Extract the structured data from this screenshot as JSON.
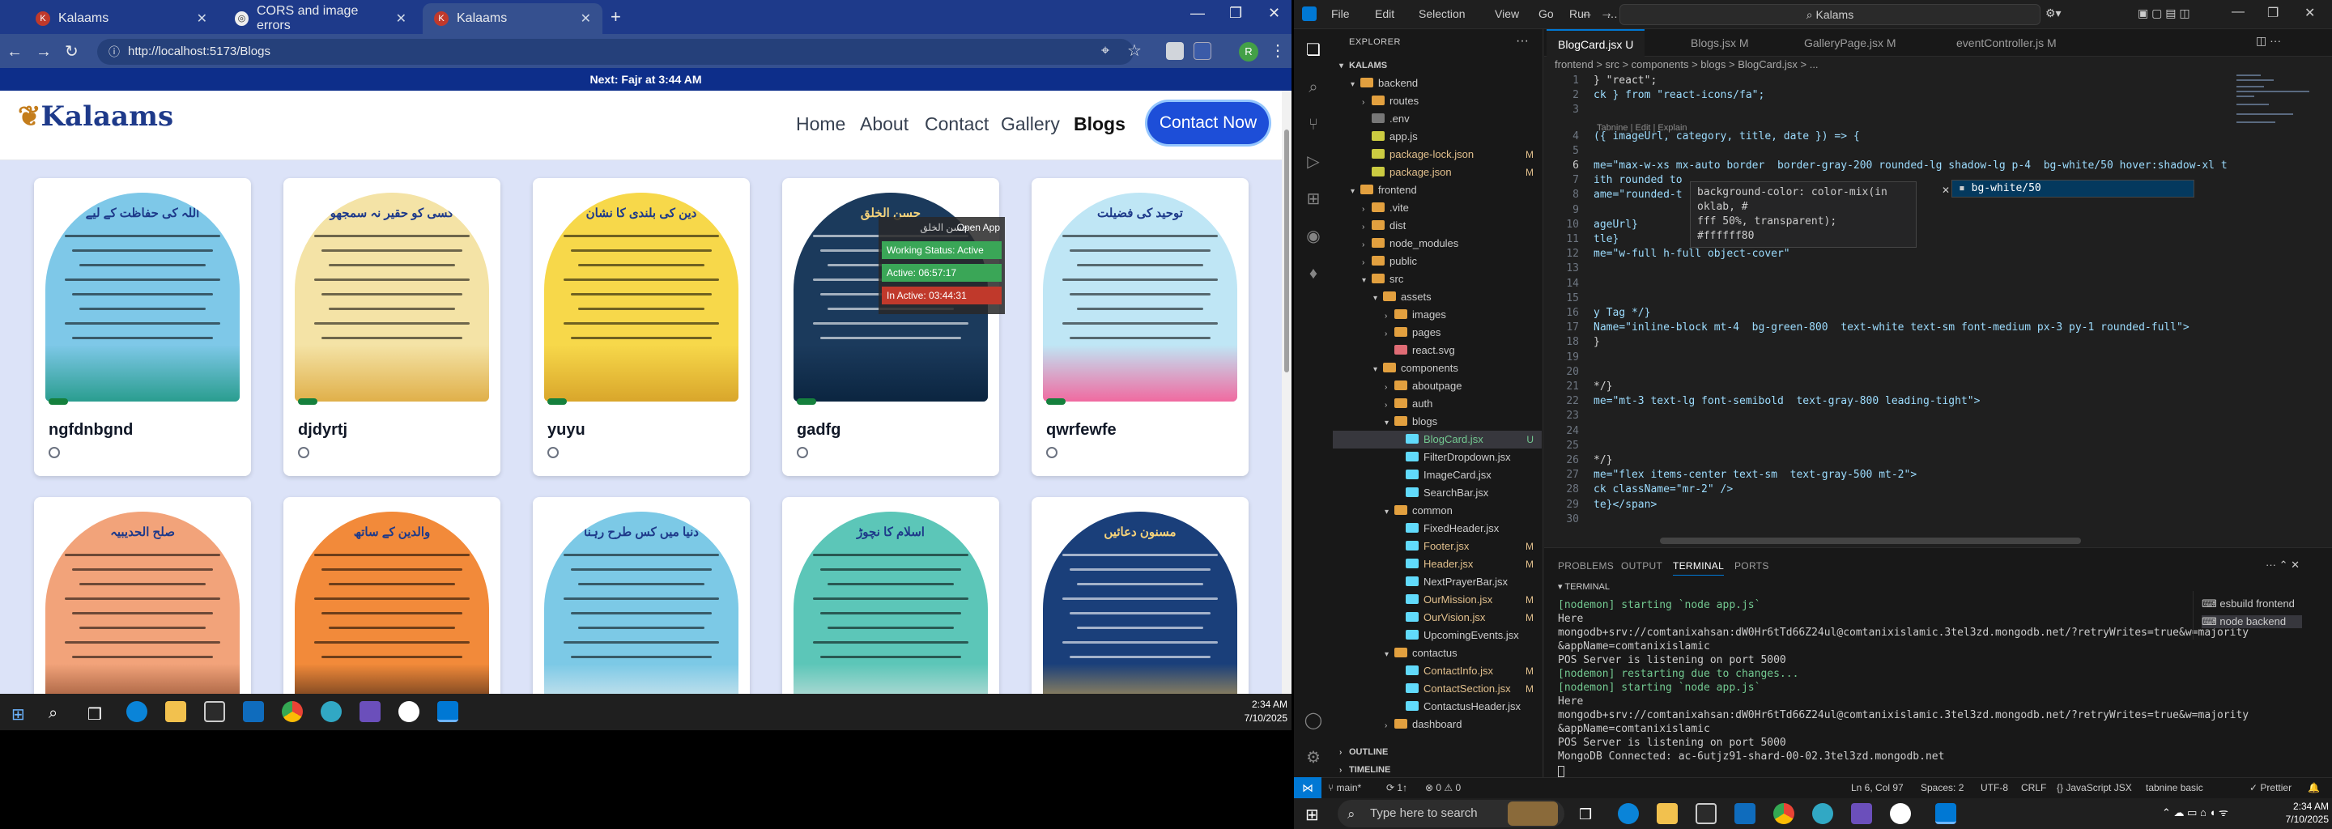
{
  "browser": {
    "tabs": [
      {
        "label": "Kalaams",
        "active": false
      },
      {
        "label": "CORS and image errors",
        "active": false
      },
      {
        "label": "Kalaams",
        "active": true
      }
    ],
    "url": "http://localhost:5173/Blogs",
    "announcement": "Next: Fajr at 3:44 AM"
  },
  "site": {
    "logo": "Kalaams",
    "nav": [
      "Home",
      "About",
      "Contact",
      "Gallery",
      "Blogs"
    ],
    "active_nav": "Blogs",
    "cta": "Contact Now",
    "cards": [
      {
        "title": "ngfdnbgnd",
        "heading": "اللہ کی حفاظت کے لیے",
        "bg": "#7ec8e8",
        "scene": "#2a9d8f"
      },
      {
        "title": "djdyrtj",
        "heading": "کسی کو حقیر نہ سمجھو",
        "bg": "#f4e3a6",
        "scene": "#e0b04a"
      },
      {
        "title": "yuyu",
        "heading": "دین کی بلندی کا نشان",
        "bg": "#f7d84a",
        "scene": "#d9a62b"
      },
      {
        "title": "gadfg",
        "heading": "حسن الخلق",
        "bg": "#1b3a5c",
        "scene": "#0b2540"
      },
      {
        "title": "qwrfewfe",
        "heading": "توحید کی فضیلت",
        "bg": "#bfe6f5",
        "scene": "#f06aa0"
      },
      {
        "title": "",
        "heading": "صلح الحدیبیہ",
        "bg": "#f2a37a",
        "scene": "#7a3b20"
      },
      {
        "title": "",
        "heading": "والدین کے ساتھ",
        "bg": "#f28a3a",
        "scene": "#2b1810"
      },
      {
        "title": "",
        "heading": "دنیا میں کس طرح رہنا",
        "bg": "#7cc9e6",
        "scene": "#f0f0f0"
      },
      {
        "title": "",
        "heading": "اسلام کا نچوڑ",
        "bg": "#5cc6b8",
        "scene": "#e6e6e6"
      },
      {
        "title": "",
        "heading": "مسنون دعائیں",
        "bg": "#1a3f7a",
        "scene": "#e0b04a"
      }
    ],
    "popup": {
      "title": "حسن الخلق",
      "open_app": "Open App ↗",
      "working": "Working Status: Active",
      "active": "Active: 06:57:17",
      "inactive": "In Active: 03:44:31"
    }
  },
  "taskbar1": {
    "time": "2:34 AM",
    "date": "7/10/2025"
  },
  "vscode": {
    "menu": [
      "File",
      "Edit",
      "Selection",
      "View",
      "Go",
      "Run",
      "…"
    ],
    "command_center": "Kalams",
    "explorer_label": "EXPLORER",
    "root": "KALAMS",
    "tree": [
      {
        "name": "backend",
        "depth": 1,
        "type": "folder",
        "open": true,
        "status": "",
        "color": "#e2a03f"
      },
      {
        "name": "routes",
        "depth": 2,
        "type": "folder",
        "open": false,
        "status": "",
        "color": "#e2a03f"
      },
      {
        "name": ".env",
        "depth": 2,
        "type": "file",
        "open": false,
        "status": "",
        "color": "#777"
      },
      {
        "name": "app.js",
        "depth": 2,
        "type": "file",
        "open": false,
        "status": "",
        "color": "#cbcb41"
      },
      {
        "name": "package-lock.json",
        "depth": 2,
        "type": "file",
        "open": false,
        "status": "M",
        "color": "#cbcb41"
      },
      {
        "name": "package.json",
        "depth": 2,
        "type": "file",
        "open": false,
        "status": "M",
        "color": "#cbcb41"
      },
      {
        "name": "frontend",
        "depth": 1,
        "type": "folder",
        "open": true,
        "status": "",
        "color": "#e2a03f"
      },
      {
        "name": ".vite",
        "depth": 2,
        "type": "folder",
        "open": false,
        "status": "",
        "color": "#e2a03f"
      },
      {
        "name": "dist",
        "depth": 2,
        "type": "folder",
        "open": false,
        "status": "",
        "color": "#e2a03f"
      },
      {
        "name": "node_modules",
        "depth": 2,
        "type": "folder",
        "open": false,
        "status": "",
        "color": "#e2a03f"
      },
      {
        "name": "public",
        "depth": 2,
        "type": "folder",
        "open": false,
        "status": "",
        "color": "#e2a03f"
      },
      {
        "name": "src",
        "depth": 2,
        "type": "folder",
        "open": true,
        "status": "",
        "color": "#e2a03f"
      },
      {
        "name": "assets",
        "depth": 3,
        "type": "folder",
        "open": true,
        "status": "",
        "color": "#e2a03f"
      },
      {
        "name": "images",
        "depth": 4,
        "type": "folder",
        "open": false,
        "status": "",
        "color": "#e2a03f"
      },
      {
        "name": "pages",
        "depth": 4,
        "type": "folder",
        "open": false,
        "status": "",
        "color": "#e2a03f"
      },
      {
        "name": "react.svg",
        "depth": 4,
        "type": "file",
        "open": false,
        "status": "",
        "color": "#e06c75"
      },
      {
        "name": "components",
        "depth": 3,
        "type": "folder",
        "open": true,
        "status": "",
        "color": "#e2a03f"
      },
      {
        "name": "aboutpage",
        "depth": 4,
        "type": "folder",
        "open": false,
        "status": "",
        "color": "#e2a03f"
      },
      {
        "name": "auth",
        "depth": 4,
        "type": "folder",
        "open": false,
        "status": "",
        "color": "#e2a03f"
      },
      {
        "name": "blogs",
        "depth": 4,
        "type": "folder",
        "open": true,
        "status": "",
        "color": "#e2a03f"
      },
      {
        "name": "BlogCard.jsx",
        "depth": 5,
        "type": "file",
        "open": false,
        "status": "U",
        "color": "#61dafb",
        "selected": true
      },
      {
        "name": "FilterDropdown.jsx",
        "depth": 5,
        "type": "file",
        "open": false,
        "status": "",
        "color": "#61dafb"
      },
      {
        "name": "ImageCard.jsx",
        "depth": 5,
        "type": "file",
        "open": false,
        "status": "",
        "color": "#61dafb"
      },
      {
        "name": "SearchBar.jsx",
        "depth": 5,
        "type": "file",
        "open": false,
        "status": "",
        "color": "#61dafb"
      },
      {
        "name": "common",
        "depth": 4,
        "type": "folder",
        "open": true,
        "status": "",
        "color": "#e2a03f"
      },
      {
        "name": "FixedHeader.jsx",
        "depth": 5,
        "type": "file",
        "open": false,
        "status": "",
        "color": "#61dafb"
      },
      {
        "name": "Footer.jsx",
        "depth": 5,
        "type": "file",
        "open": false,
        "status": "M",
        "color": "#61dafb"
      },
      {
        "name": "Header.jsx",
        "depth": 5,
        "type": "file",
        "open": false,
        "status": "M",
        "color": "#61dafb"
      },
      {
        "name": "NextPrayerBar.jsx",
        "depth": 5,
        "type": "file",
        "open": false,
        "status": "",
        "color": "#61dafb"
      },
      {
        "name": "OurMission.jsx",
        "depth": 5,
        "type": "file",
        "open": false,
        "status": "M",
        "color": "#61dafb"
      },
      {
        "name": "OurVision.jsx",
        "depth": 5,
        "type": "file",
        "open": false,
        "status": "M",
        "color": "#61dafb"
      },
      {
        "name": "UpcomingEvents.jsx",
        "depth": 5,
        "type": "file",
        "open": false,
        "status": "",
        "color": "#61dafb"
      },
      {
        "name": "contactus",
        "depth": 4,
        "type": "folder",
        "open": true,
        "status": "",
        "color": "#e2a03f"
      },
      {
        "name": "ContactInfo.jsx",
        "depth": 5,
        "type": "file",
        "open": false,
        "status": "M",
        "color": "#61dafb"
      },
      {
        "name": "ContactSection.jsx",
        "depth": 5,
        "type": "file",
        "open": false,
        "status": "M",
        "color": "#61dafb"
      },
      {
        "name": "ContactusHeader.jsx",
        "depth": 5,
        "type": "file",
        "open": false,
        "status": "",
        "color": "#61dafb"
      },
      {
        "name": "dashboard",
        "depth": 4,
        "type": "folder",
        "open": false,
        "status": "",
        "color": "#e2a03f"
      }
    ],
    "outline": "OUTLINE",
    "timeline": "TIMELINE",
    "tabs": [
      {
        "label": "BlogCard.jsx U",
        "active": true
      },
      {
        "label": "Blogs.jsx M",
        "active": false
      },
      {
        "label": "GalleryPage.jsx M",
        "active": false
      },
      {
        "label": "eventController.js M",
        "active": false
      }
    ],
    "breadcrumb": "frontend > src > components > blogs > BlogCard.jsx > ...",
    "lines": [
      {
        "n": "1",
        "text": "} \"react\";"
      },
      {
        "n": "2",
        "text": "ck } from \"react-icons/fa\";"
      },
      {
        "n": "3",
        "text": ""
      },
      {
        "n": "4",
        "text": "({ imageUrl, category, title, date }) => {"
      },
      {
        "n": "5",
        "text": ""
      },
      {
        "n": "6",
        "text": "me=\"max-w-xs mx-auto border  border-gray-200 rounded-lg shadow-lg p-4  bg-white/50 hover:shadow-xl t"
      },
      {
        "n": "7",
        "text": "ith rounded to"
      },
      {
        "n": "8",
        "text": "ame=\"rounded-t"
      },
      {
        "n": "9",
        "text": ""
      },
      {
        "n": "10",
        "text": "ageUrl}"
      },
      {
        "n": "11",
        "text": "tle}"
      },
      {
        "n": "12",
        "text": "me=\"w-full h-full object-cover\""
      },
      {
        "n": "13",
        "text": ""
      },
      {
        "n": "14",
        "text": ""
      },
      {
        "n": "15",
        "text": ""
      },
      {
        "n": "16",
        "text": "y Tag */}"
      },
      {
        "n": "17",
        "text": "Name=\"inline-block mt-4  bg-green-800  text-white text-sm font-medium px-3 py-1 rounded-full\">"
      },
      {
        "n": "18",
        "text": "}"
      },
      {
        "n": "19",
        "text": ""
      },
      {
        "n": "20",
        "text": ""
      },
      {
        "n": "21",
        "text": "*/}"
      },
      {
        "n": "22",
        "text": "me=\"mt-3 text-lg font-semibold  text-gray-800 leading-tight\">"
      },
      {
        "n": "23",
        "text": ""
      },
      {
        "n": "24",
        "text": ""
      },
      {
        "n": "25",
        "text": ""
      },
      {
        "n": "26",
        "text": "*/}"
      },
      {
        "n": "27",
        "text": "me=\"flex items-center text-sm  text-gray-500 mt-2\">"
      },
      {
        "n": "28",
        "text": "ck className=\"mr-2\" />"
      },
      {
        "n": "29",
        "text": "te}</span>"
      },
      {
        "n": "30",
        "text": ""
      }
    ],
    "tabnine": "Tabnine | Edit | Explain",
    "hover": [
      "background-color: color-mix(in oklab, #",
      "fff 50%, transparent);",
      "",
      "#ffffff80"
    ],
    "suggestion": "bg-white/50",
    "panel_tabs": [
      "PROBLEMS",
      "OUTPUT",
      "TERMINAL",
      "PORTS"
    ],
    "terminal_label": "TERMINAL",
    "terminal": [
      "[nodemon] starting `node app.js`",
      "Here",
      "mongodb+srv://comtanixahsan:dW0Hr6tTd66Z24ul@comtanixislamic.3tel3zd.mongodb.net/?retryWrites=true&w=majority",
      "&appName=comtanixislamic",
      "POS Server is listening on port 5000",
      "[nodemon] restarting due to changes...",
      "[nodemon] starting `node app.js`",
      "Here",
      "mongodb+srv://comtanixahsan:dW0Hr6tTd66Z24ul@comtanixislamic.3tel3zd.mongodb.net/?retryWrites=true&w=majority",
      "&appName=comtanixislamic",
      "POS Server is listening on port 5000",
      "MongoDB Connected: ac-6utjz91-shard-00-02.3tel3zd.mongodb.net"
    ],
    "term_sessions": [
      "esbuild frontend",
      "node backend"
    ],
    "status": {
      "branch": "main*",
      "sync": "⟳ 1↑",
      "problems": "⊗ 0 ⚠ 0",
      "position": "Ln 6, Col 97",
      "spaces": "Spaces: 2",
      "encoding": "UTF-8",
      "eol": "CRLF",
      "language": "{} JavaScript JSX",
      "tabnine": "tabnine basic",
      "prettier": "✓ Prettier"
    }
  },
  "taskbar2": {
    "search": "Type here to search",
    "time": "2:34 AM",
    "date": "7/10/2025"
  }
}
